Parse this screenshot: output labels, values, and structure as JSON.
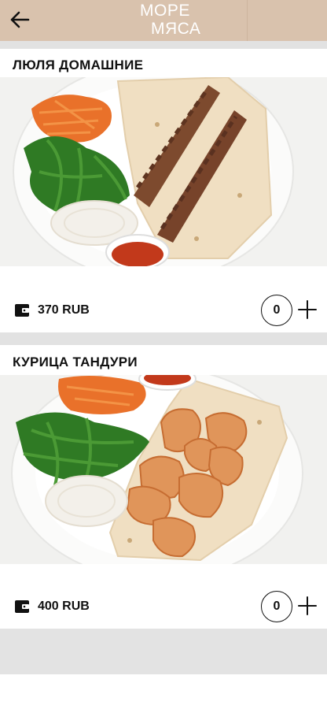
{
  "header": {
    "logo_line1": "МОРЕ",
    "logo_line2": "МЯСА",
    "colors": {
      "background": "#d9c2ad",
      "logo": "#ffffff"
    }
  },
  "products": [
    {
      "title": "ЛЮЛЯ ДОМАШНИЕ",
      "price": "370 RUB",
      "quantity": "0",
      "image_icon": "lula-kebab-plate-photo"
    },
    {
      "title": "КУРИЦА ТАНДУРИ",
      "price": "400 RUB",
      "quantity": "0",
      "image_icon": "tandoori-chicken-plate-photo"
    }
  ],
  "icons": {
    "back": "arrow-left-icon",
    "wallet": "wallet-icon",
    "add": "plus-icon"
  }
}
